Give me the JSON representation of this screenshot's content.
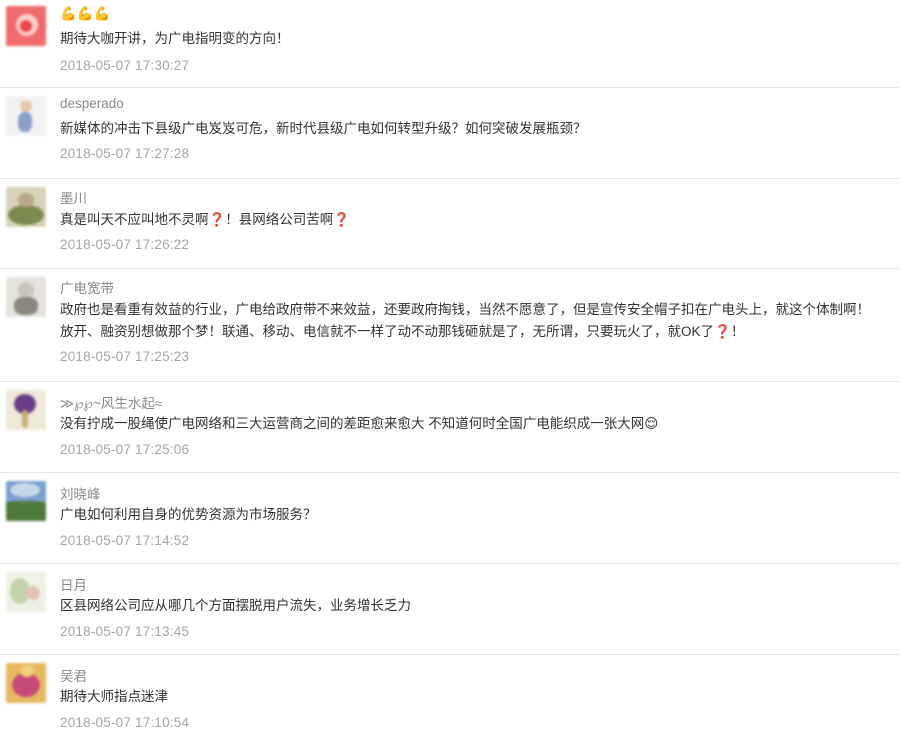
{
  "comments": [
    {
      "nickname": "💪💪💪",
      "text": "期待大咖开讲，为广电指明变的方向！",
      "time": "2018-05-07 17:30:27",
      "avatar_colors": [
        "#f06b6b",
        "#e94848",
        "#ffd0d0"
      ]
    },
    {
      "nickname": "desperado",
      "text": "新媒体的冲击下县级广电岌岌可危，新时代县级广电如何转型升级？如何突破发展瓶颈？",
      "time": "2018-05-07 17:27:28",
      "avatar_colors": [
        "#f2f2f2",
        "#8aa0c8",
        "#e8c9b0"
      ]
    },
    {
      "nickname": "墨川",
      "text": "真是叫天不应叫地不灵啊❓！县网络公司苦啊❓",
      "time": "2018-05-07 17:26:22",
      "avatar_colors": [
        "#d8d2b8",
        "#7c8a4e",
        "#b8a888"
      ]
    },
    {
      "nickname": "广电宽带",
      "text": "政府也是看重有效益的行业，广电给政府带不来效益，还要政府掏钱，当然不愿意了，但是宣传安全帽子扣在广电头上，就这个体制啊！放开、融资别想做那个梦！联通、移动、电信就不一样了动不动那钱砸就是了，无所谓，只要玩火了，就OK了❓！",
      "time": "2018-05-07 17:25:23",
      "avatar_colors": [
        "#e6e3de",
        "#8a8680",
        "#c9c4bc"
      ]
    },
    {
      "nickname": "≫℘℘~风生水起≈",
      "text": "没有拧成一股绳使广电网络和三大运营商之间的差距愈来愈大 不知道何时全国广电能织成一张大网😌",
      "time": "2018-05-07 17:25:06",
      "avatar_colors": [
        "#efe9d8",
        "#6a3f8a",
        "#c8b070"
      ]
    },
    {
      "nickname": "刘晓峰",
      "text": "广电如何利用自身的优势资源为市场服务？",
      "time": "2018-05-07 17:14:52",
      "avatar_colors": [
        "#7aa0d0",
        "#4f7a3c",
        "#c9d8e8"
      ]
    },
    {
      "nickname": "日月",
      "text": "区县网络公司应从哪几个方面摆脱用户流失，业务增长乏力",
      "time": "2018-05-07 17:13:45",
      "avatar_colors": [
        "#eef2e6",
        "#c4d4a8",
        "#e7c2b8"
      ]
    },
    {
      "nickname": "吴君",
      "text": "期待大师指点迷津",
      "time": "2018-05-07 17:10:54",
      "avatar_colors": [
        "#e8b860",
        "#c84a78",
        "#f0d080"
      ]
    }
  ]
}
